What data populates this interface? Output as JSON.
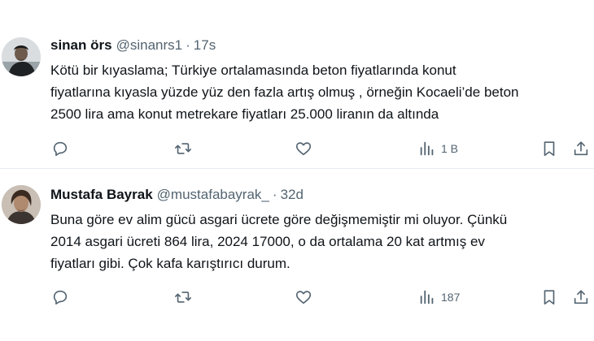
{
  "tweets": [
    {
      "display_name": "sinan örs",
      "handle": "@sinanrs1",
      "separator": "·",
      "time": "17s",
      "lines": [
        "Kötü bir kıyaslama; Türkiye ortalamasında beton fiyatlarında konut",
        "fiyatlarına kıyasla yüzde yüz den fazla artış olmuş , örneğin Kocaeli’de beton",
        "2500 lira ama konut metrekare fiyatları 25.000 liranın da altında"
      ],
      "views": "1 B"
    },
    {
      "display_name": "Mustafa Bayrak",
      "handle": "@mustafabayrak_",
      "separator": "·",
      "time": "32d",
      "lines": [
        "Buna göre ev alim gücü asgari ücrete göre değişmemiştir mi oluyor. Çünkü",
        "2014 asgari ücreti 864 lira, 2024 17000, o da ortalama 20 kat artmış ev",
        "fiyatları gibi. Çok kafa karıştırıcı durum."
      ],
      "views": "187"
    }
  ],
  "colors": {
    "text": "#0f1419",
    "secondary": "#536471",
    "divider": "#e6ecf0"
  },
  "icons": [
    "reply-icon",
    "retweet-icon",
    "like-icon",
    "views-icon",
    "bookmark-icon",
    "share-icon"
  ]
}
